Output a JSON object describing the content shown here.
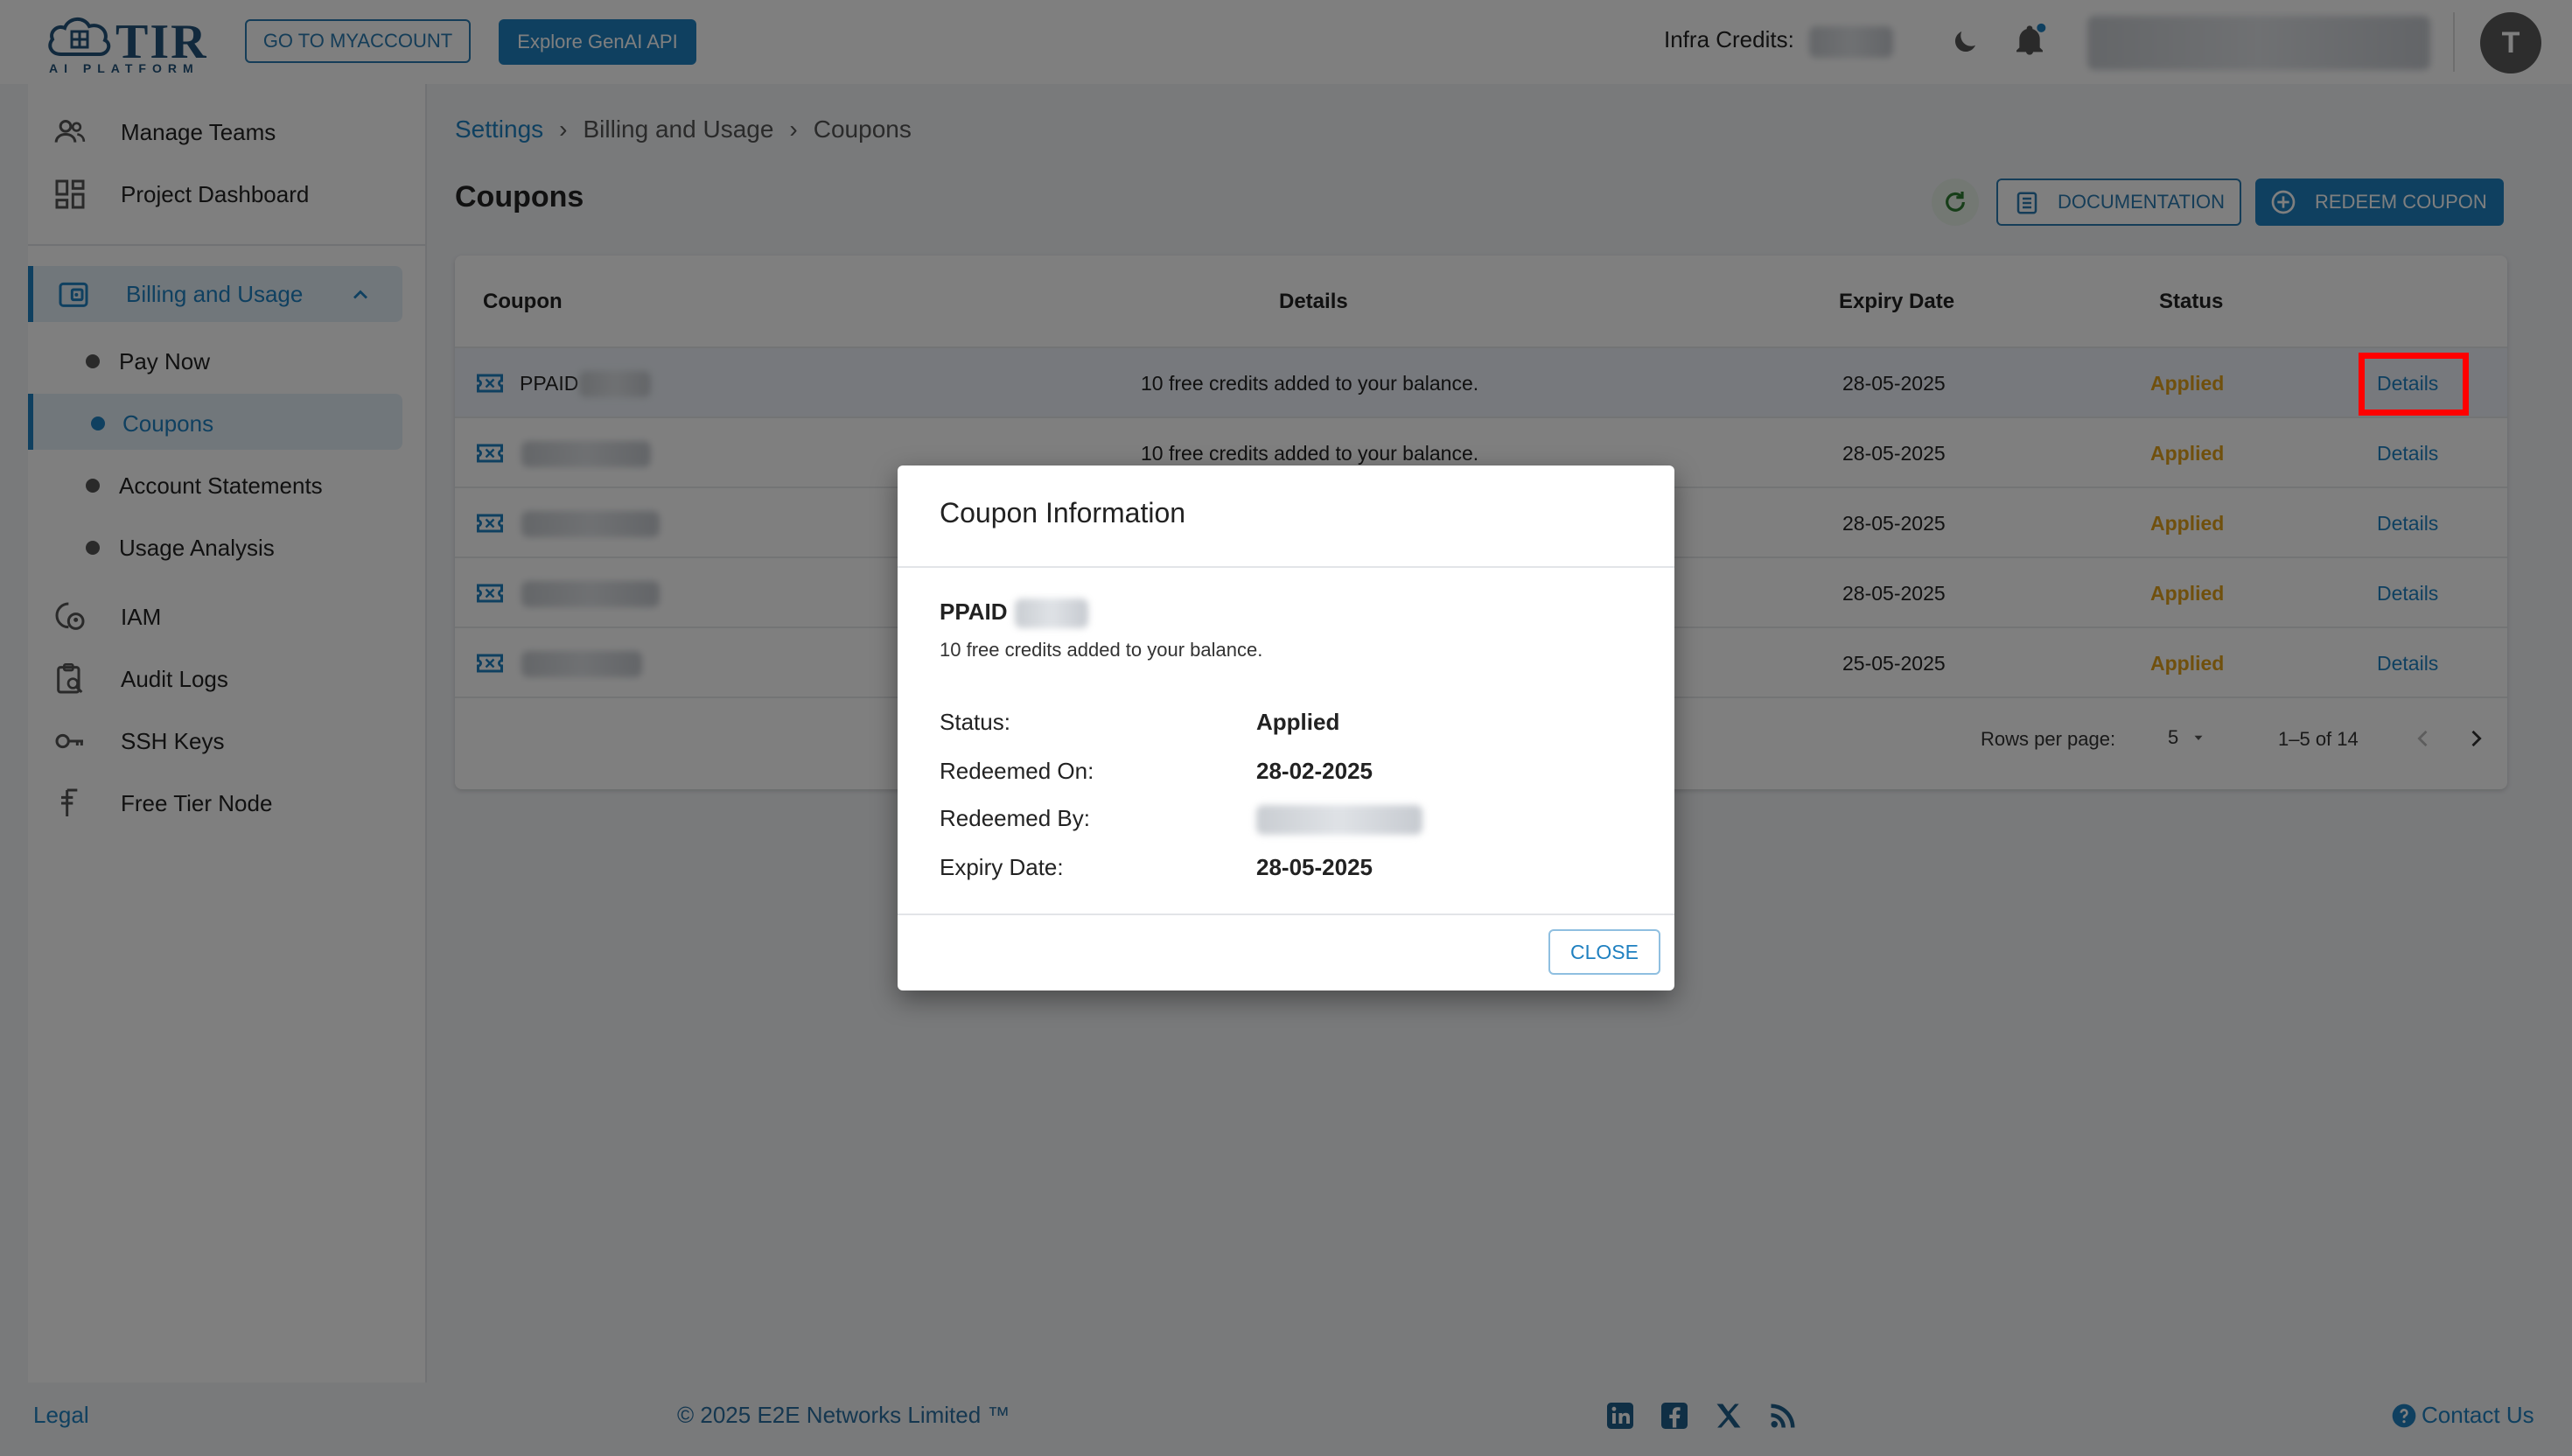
{
  "header": {
    "logo_text": "TIR",
    "logo_sub": "AI PLATFORM",
    "myaccount_button": "GO TO MYACCOUNT",
    "genai_button": "Explore GenAI API",
    "credits_label": "Infra Credits:",
    "avatar_letter": "T"
  },
  "sidebar": {
    "items": [
      {
        "label": "Manage Teams",
        "icon": "users-icon"
      },
      {
        "label": "Project Dashboard",
        "icon": "dashboard-icon"
      },
      {
        "label": "Billing and Usage",
        "icon": "wallet-icon"
      },
      {
        "label": "Pay Now"
      },
      {
        "label": "Coupons"
      },
      {
        "label": "Account Statements"
      },
      {
        "label": "Usage Analysis"
      },
      {
        "label": "IAM",
        "icon": "iam-icon"
      },
      {
        "label": "Audit Logs",
        "icon": "audit-icon"
      },
      {
        "label": "SSH Keys",
        "icon": "key-icon"
      },
      {
        "label": "Free Tier Node",
        "icon": "free-tier-icon"
      }
    ]
  },
  "breadcrumb": {
    "items": [
      "Settings",
      "Billing and Usage",
      "Coupons"
    ],
    "separator": "›"
  },
  "page": {
    "title": "Coupons",
    "documentation_button": "DOCUMENTATION",
    "redeem_button": "REDEEM COUPON"
  },
  "table": {
    "headers": [
      "Coupon",
      "Details",
      "Expiry Date",
      "Status"
    ],
    "rows": [
      {
        "coupon": "PPAID",
        "details": "10 free credits added to your balance.",
        "expiry": "28-05-2025",
        "status": "Applied",
        "action": "Details"
      },
      {
        "coupon": "",
        "details": "10 free credits added to your balance.",
        "expiry": "28-05-2025",
        "status": "Applied",
        "action": "Details"
      },
      {
        "coupon": "",
        "details": "",
        "expiry": "28-05-2025",
        "status": "Applied",
        "action": "Details"
      },
      {
        "coupon": "",
        "details": "",
        "expiry": "28-05-2025",
        "status": "Applied",
        "action": "Details"
      },
      {
        "coupon": "",
        "details": "",
        "expiry": "25-05-2025",
        "status": "Applied",
        "action": "Details"
      }
    ],
    "rows_per_page_label": "Rows per page:",
    "rows_per_page_value": "5",
    "range": "1–5 of 14"
  },
  "modal": {
    "title": "Coupon Information",
    "code": "PPAID",
    "description": "10 free credits added to your balance.",
    "fields": [
      {
        "label": "Status:",
        "value": "Applied"
      },
      {
        "label": "Redeemed On:",
        "value": "28-02-2025"
      },
      {
        "label": "Redeemed By:",
        "value": ""
      },
      {
        "label": "Expiry Date:",
        "value": "28-05-2025"
      }
    ],
    "close_button": "CLOSE"
  },
  "footer": {
    "legal": "Legal",
    "copyright": "© 2025 E2E Networks Limited ™",
    "contact": "Contact Us"
  },
  "colors": {
    "accent": "#1f80c0",
    "applied": "#e0a11b",
    "highlight_box": "#ff0000"
  }
}
